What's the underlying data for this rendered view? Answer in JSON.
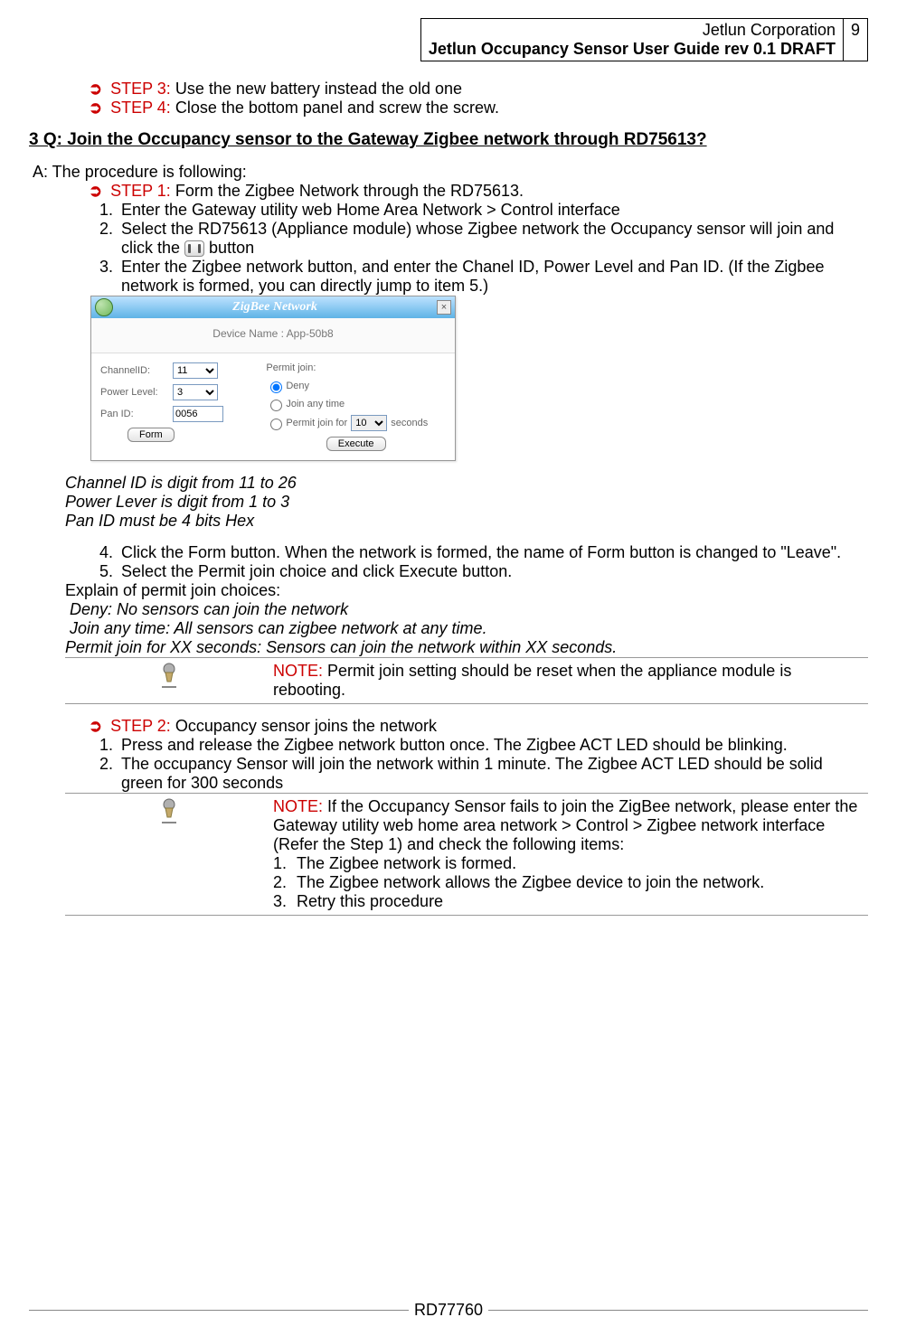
{
  "header": {
    "company": "Jetlun Corporation",
    "doc_title": "Jetlun  Occupancy Sensor User Guide rev 0.1 DRAFT",
    "page_number": "9"
  },
  "top_steps": {
    "step3_label": "STEP 3:",
    "step3_text": "Use the new battery instead the old one",
    "step4_label": "STEP 4:",
    "step4_text": "Close the bottom panel and screw the screw."
  },
  "question3": {
    "heading": "3 Q: Join the Occupancy sensor to the Gateway Zigbee network through RD75613?",
    "answer_intro": "A: The procedure is following:",
    "step1_label": "STEP 1:",
    "step1_text": "Form the Zigbee Network through the RD75613.",
    "list1": {
      "i1": "Enter the Gateway utility web Home Area Network > Control interface",
      "i2_pre": "Select the RD75613 (Appliance module) whose Zigbee network the Occupancy sensor will join and click the ",
      "i2_post": " button",
      "i3": "Enter the Zigbee network button, and enter the Chanel ID, Power Level and Pan ID. (If the Zigbee network is formed, you can directly jump to item 5.)"
    },
    "dialog": {
      "title": "ZigBee Network",
      "close_label": "×",
      "device_name_label": "Device Name : ",
      "device_name_value": "App-50b8",
      "channel_id_label": "ChannelID:",
      "channel_id_value": "11",
      "power_level_label": "Power Level:",
      "power_level_value": "3",
      "pan_id_label": "Pan ID:",
      "pan_id_value": "0056",
      "form_button": "Form",
      "permit_join_label": "Permit join:",
      "deny_label": "Deny",
      "join_any_time_label": "Join any time",
      "permit_for_pre": "Permit join for",
      "permit_for_value": "10",
      "permit_for_post": "seconds",
      "execute_button": "Execute"
    },
    "notes1": {
      "l1": "Channel ID is digit from 11 to 26",
      "l2": "Power Lever is digit from 1 to 3",
      "l3": "Pan ID must be 4 bits Hex"
    },
    "list2": {
      "i4": "Click the Form button. When the network is formed, the name of Form button is changed to \"Leave\".",
      "i5": "Select the Permit join choice and click Execute button."
    },
    "explain": {
      "intro": "Explain of permit join choices:",
      "deny": "Deny: No sensors can join the network",
      "any": "Join any time: All sensors can zigbee network at any time.",
      "permit": "Permit join for XX seconds: Sensors can join the network within XX seconds."
    },
    "notebox1": {
      "label": "NOTE:",
      "text": "  Permit join setting should be reset when the appliance module is rebooting."
    },
    "step2_label": "STEP 2:",
    "step2_text": "Occupancy sensor joins the network",
    "list3": {
      "i1": "Press and release the Zigbee network button once. The Zigbee ACT LED should be blinking.",
      "i2": "The occupancy Sensor will join the network within 1 minute. The Zigbee ACT LED should be solid green for 300 seconds"
    },
    "notebox2": {
      "label": "NOTE:",
      "intro": "  If the Occupancy Sensor fails to join the ZigBee network, please enter the Gateway utility web home area network > Control > Zigbee network interface (Refer the Step 1) and check the following items:",
      "items": {
        "n1": "The Zigbee network is formed.",
        "n2": "The Zigbee network allows the Zigbee device to join the network.",
        "n3": "Retry this procedure"
      }
    }
  },
  "footer": {
    "doc_id": "RD77760"
  }
}
